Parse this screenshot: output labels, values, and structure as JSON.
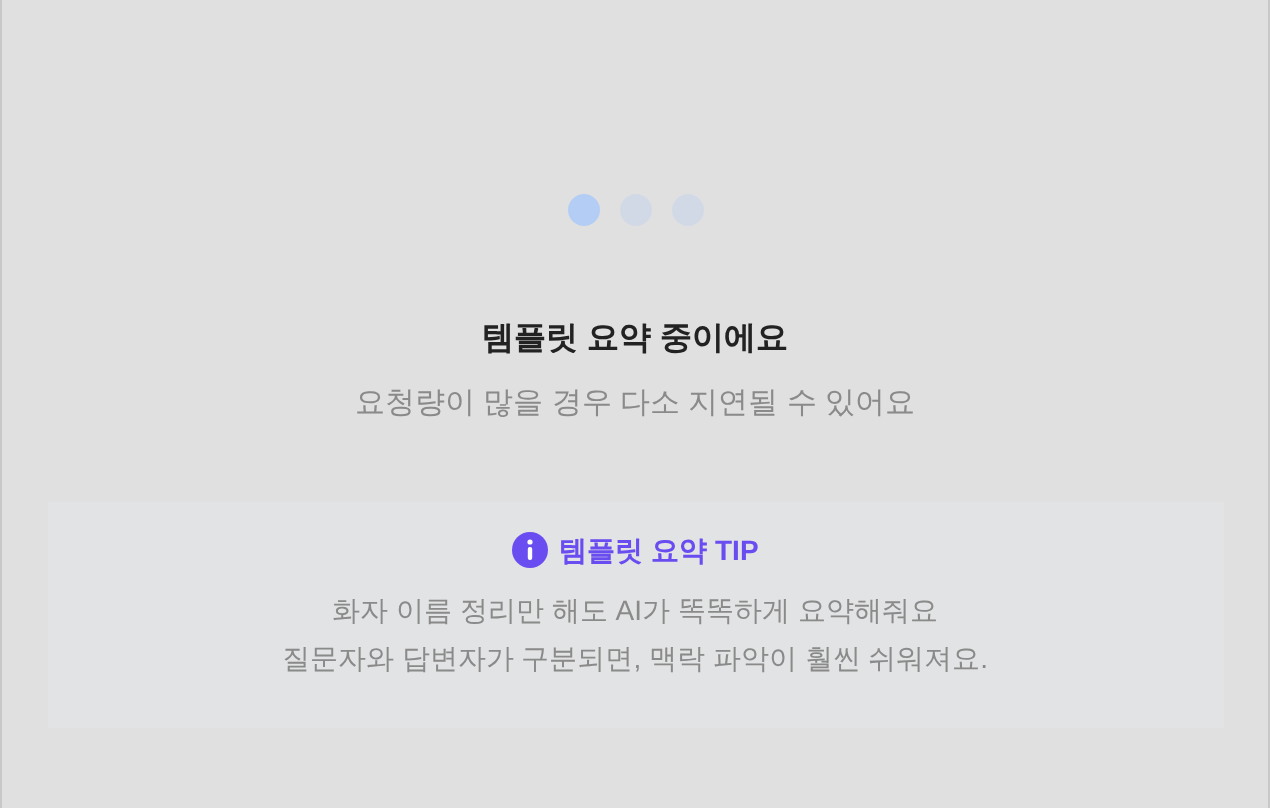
{
  "loader": {
    "dots": [
      {
        "active": true
      },
      {
        "active": false
      },
      {
        "active": false
      }
    ]
  },
  "title": "템플릿 요약 중이에요",
  "subtitle": "요청량이 많을 경우 다소 지연될 수 있어요",
  "tip": {
    "title": "템플릿 요약 TIP",
    "lines": [
      "화자 이름 정리만 해도 AI가 똑똑하게 요약해줘요",
      "질문자와 답변자가 구분되면, 맥락 파악이 훨씬 쉬워져요."
    ]
  }
}
